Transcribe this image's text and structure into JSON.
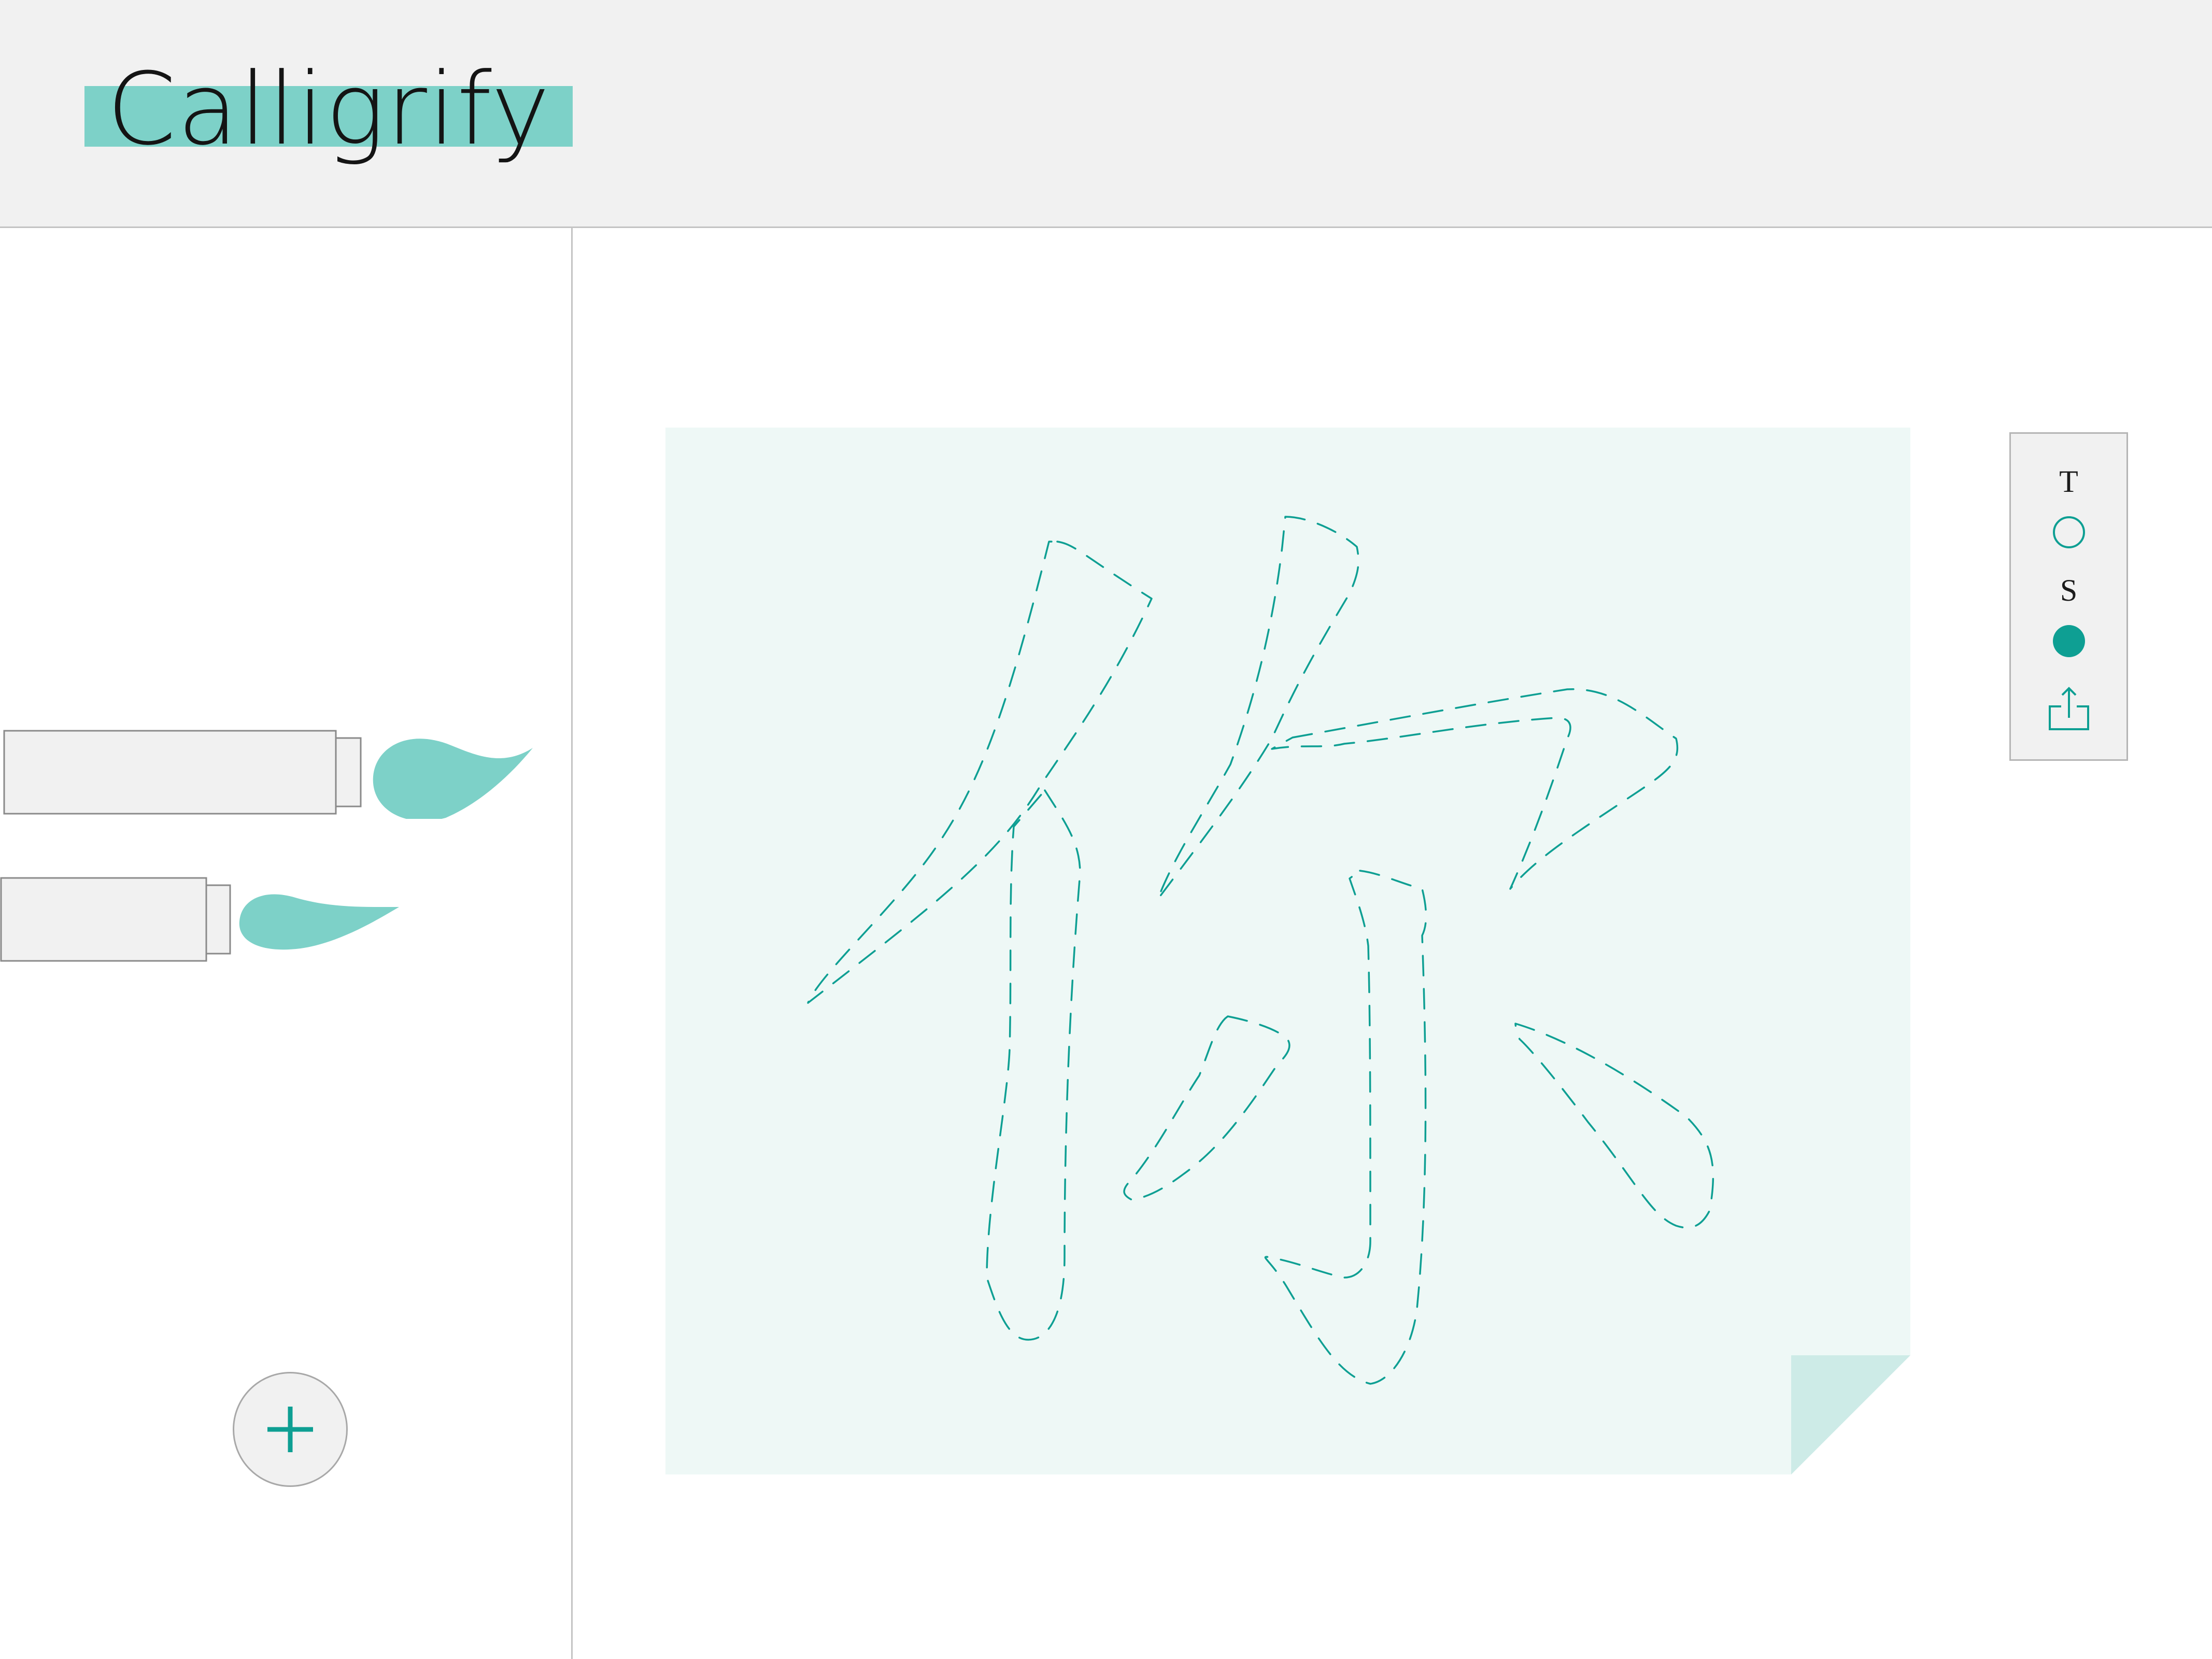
{
  "app": {
    "title": "Calligrify",
    "accent_color": "#7dd1c8",
    "primary_color": "#0e9f93"
  },
  "left_panel": {
    "brushes": [
      {
        "name": "large-brush",
        "icon": "brush-large-icon"
      },
      {
        "name": "small-brush",
        "icon": "brush-small-icon"
      }
    ],
    "add_button_icon": "plus-icon"
  },
  "canvas": {
    "paper_color": "#eef8f6",
    "fold_color": "#cdebe7",
    "guide_character": "你",
    "guide_style": "dashed-outline"
  },
  "palette": {
    "text_label": "T",
    "stroke_label": "S",
    "text_option_state": "unselected",
    "stroke_option_state": "selected",
    "share_icon": "share-icon"
  }
}
